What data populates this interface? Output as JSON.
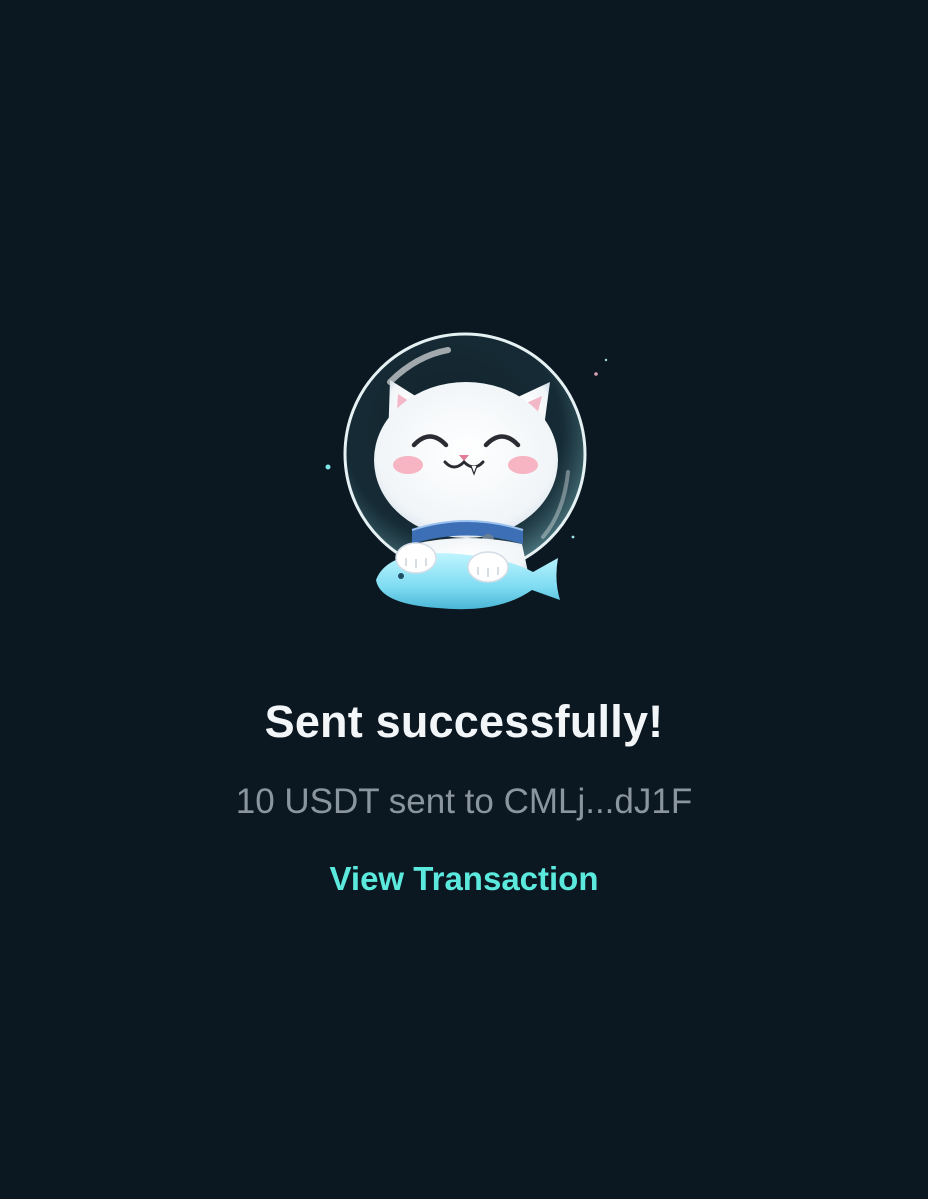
{
  "result": {
    "title": "Sent successfully!",
    "message": "10 USDT sent to CMLj...dJ1F",
    "view_transaction_label": "View Transaction"
  },
  "colors": {
    "background": "#0b1822",
    "title": "#f3f6f8",
    "message": "#8b959d",
    "link": "#5ce9dd"
  },
  "illustration": {
    "icon": "astronaut-cat-icon"
  }
}
